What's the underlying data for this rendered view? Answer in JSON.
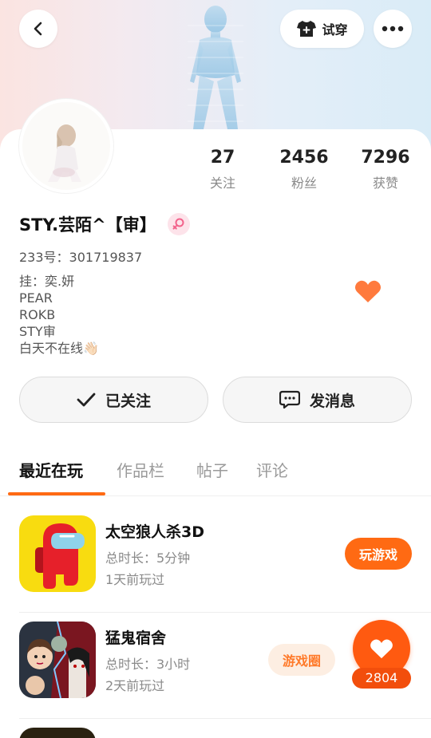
{
  "header": {
    "tryon_label": "试穿"
  },
  "profile": {
    "name": "STY.芸陌^【审】",
    "uid": "233号：301719837",
    "bio_lines": [
      "挂：奕.妍",
      "PEAR",
      "ROKB",
      "STY审",
      "白天不在线👋🏻"
    ],
    "stats": [
      {
        "value": "27",
        "label": "关注"
      },
      {
        "value": "2456",
        "label": "粉丝"
      },
      {
        "value": "7296",
        "label": "获赞"
      }
    ]
  },
  "actions": {
    "follow_label": "已关注",
    "message_label": "发消息"
  },
  "tabs": [
    {
      "label": "最近在玩",
      "active": true
    },
    {
      "label": "作品栏",
      "active": false
    },
    {
      "label": "帖子",
      "active": false
    },
    {
      "label": "评论",
      "active": false
    }
  ],
  "games": [
    {
      "title": "太空狼人杀3D",
      "duration": "总时长：5分钟",
      "last_played": "1天前玩过",
      "button": "玩游戏"
    },
    {
      "title": "猛鬼宿舍",
      "duration": "总时长：3小时",
      "last_played": "2天前玩过",
      "button": "游戏圈"
    }
  ],
  "like_fab": {
    "count": "2804"
  },
  "colors": {
    "accent": "#ff6a13",
    "heart": "#ff7a3d",
    "gender": "#f2628b"
  }
}
